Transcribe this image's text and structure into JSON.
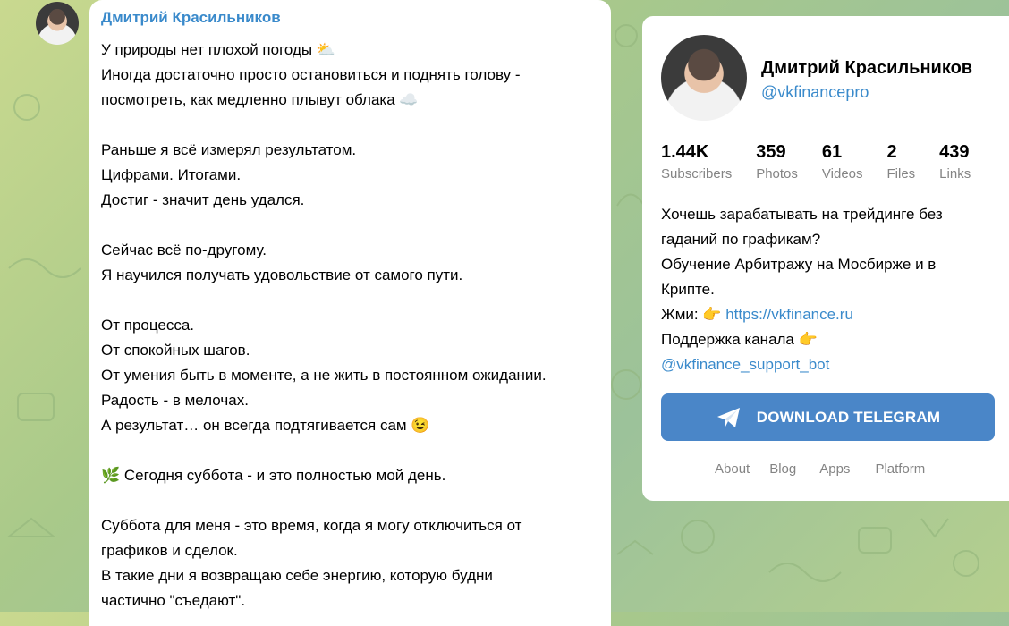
{
  "message": {
    "author": "Дмитрий Красильников",
    "lines": [
      "У природы нет плохой погоды ⛅",
      "Иногда достаточно просто остановиться и поднять голову -",
      "посмотреть, как медленно плывут облака ☁️",
      "",
      "Раньше я всё измерял результатом.",
      "Цифрами. Итогами.",
      "Достиг - значит день удался.",
      "",
      "Сейчас всё по-другому.",
      "Я научился получать удовольствие от самого пути.",
      "",
      "От процесса.",
      "От спокойных шагов.",
      "От умения быть в моменте, а не жить в постоянном ожидании.",
      "Радость - в мелочах.",
      "А результат… он всегда подтягивается сам 😉",
      "",
      "🌿 Сегодня суббота - и это полностью мой день.",
      "",
      "Суббота для меня - это время, когда я могу отключиться от",
      "графиков и сделок.",
      "В такие дни я возвращаю себе энергию, которую будни",
      "частично \"съедают\"."
    ]
  },
  "channel": {
    "name": "Дмитрий Красильников",
    "username": "@vkfinancepro",
    "stats": [
      {
        "value": "1.44K",
        "label": "Subscribers"
      },
      {
        "value": "359",
        "label": "Photos"
      },
      {
        "value": "61",
        "label": "Videos"
      },
      {
        "value": "2",
        "label": "Files"
      },
      {
        "value": "439",
        "label": "Links"
      }
    ],
    "description": {
      "line1": "Хочешь зарабатывать на трейдинге без",
      "line2": "гаданий по графикам?",
      "line3": "Обучение Арбитражу на Мосбирже и в",
      "line4": "Крипте.",
      "line5_prefix": "Жми: 👉 ",
      "line5_link": "https://vkfinance.ru",
      "line6": "Поддержка канала 👉",
      "line7_link": "@vkfinance_support_bot"
    },
    "download_label": "DOWNLOAD TELEGRAM",
    "footer": [
      "About",
      "Blog",
      "Apps",
      "Platform"
    ]
  },
  "colors": {
    "accent": "#3a8acb",
    "button": "#4a86c8",
    "muted": "#848484"
  },
  "icons": {
    "button_icon": "telegram-plane-icon"
  }
}
